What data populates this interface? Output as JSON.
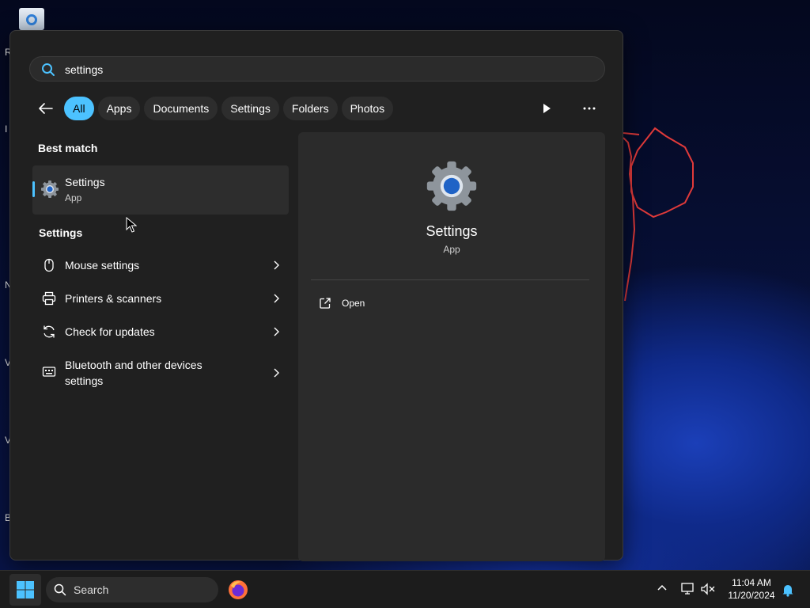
{
  "search": {
    "value": "settings"
  },
  "filters": [
    "All",
    "Apps",
    "Documents",
    "Settings",
    "Folders",
    "Photos"
  ],
  "best_match": {
    "title": "Best match",
    "name": "Settings",
    "type": "App"
  },
  "settings_section": {
    "title": "Settings",
    "items": [
      {
        "label": "Mouse settings",
        "icon": "mouse-icon"
      },
      {
        "label": "Printers & scanners",
        "icon": "printer-icon"
      },
      {
        "label": "Check for updates",
        "icon": "refresh-icon"
      },
      {
        "label": "Bluetooth and other devices settings",
        "icon": "devices-icon"
      }
    ]
  },
  "detail": {
    "name": "Settings",
    "type": "App",
    "action": "Open"
  },
  "taskbar": {
    "search_placeholder": "Search",
    "time": "11:04 AM",
    "date": "11/20/2024"
  },
  "desktop_letters": [
    "R",
    "I",
    "N",
    "V",
    "V",
    "B"
  ],
  "colors": {
    "accent": "#4cc2ff",
    "panel": "#202020",
    "detail_panel": "#2b2b2b"
  }
}
